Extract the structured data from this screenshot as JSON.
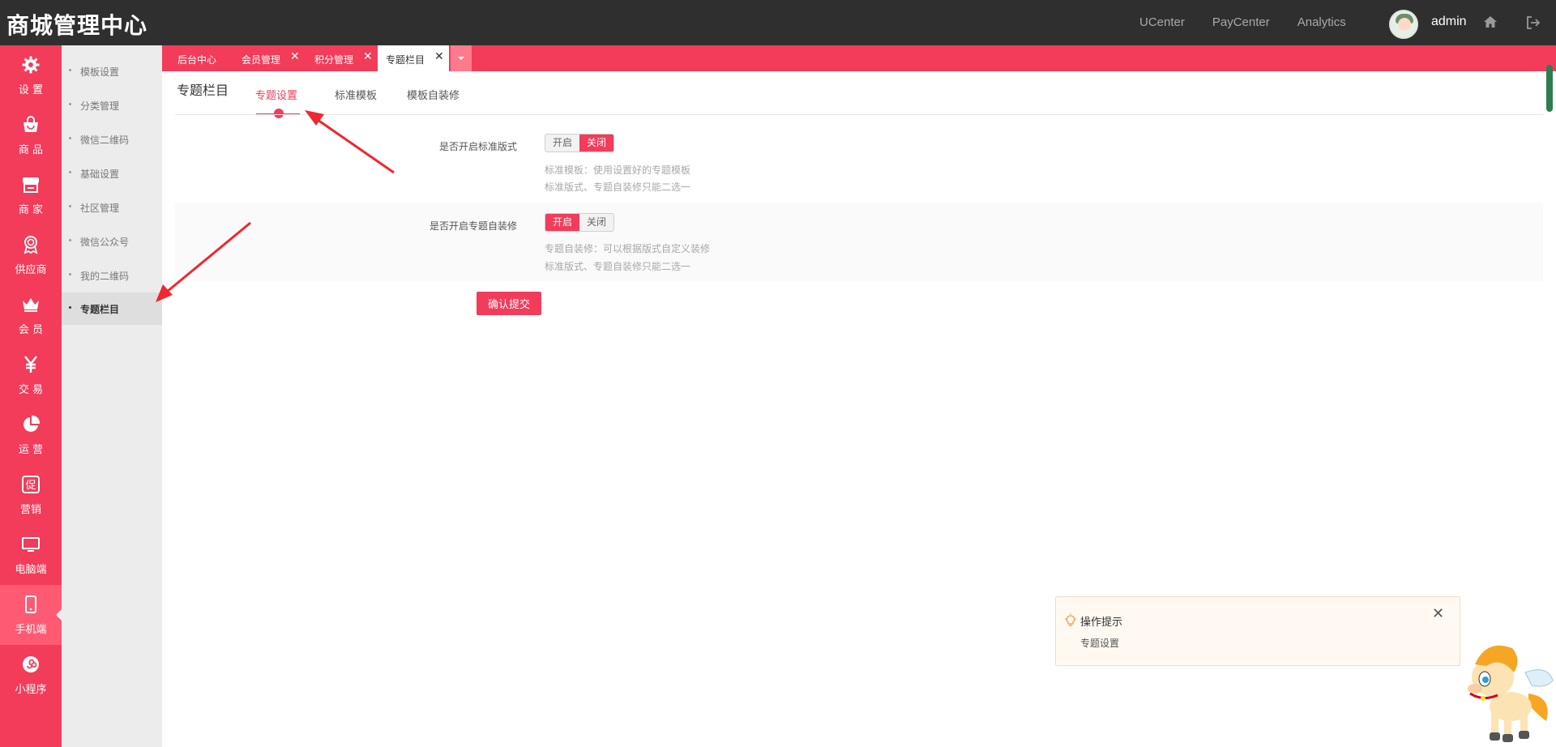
{
  "header": {
    "brand": "商城管理中心",
    "links": [
      "UCenter",
      "PayCenter",
      "Analytics"
    ],
    "username": "admin"
  },
  "primary_nav": [
    {
      "label": "设 置",
      "icon": "gear-icon"
    },
    {
      "label": "商 品",
      "icon": "bag-icon"
    },
    {
      "label": "商 家",
      "icon": "store-icon"
    },
    {
      "label": "供应商",
      "icon": "badge-icon"
    },
    {
      "label": "会 员",
      "icon": "crown-icon"
    },
    {
      "label": "交 易",
      "icon": "yen-icon"
    },
    {
      "label": "运 营",
      "icon": "pie-chart-icon"
    },
    {
      "label": "营销",
      "icon": "promo-icon"
    },
    {
      "label": "电脑端",
      "icon": "monitor-icon"
    },
    {
      "label": "手机端",
      "icon": "mobile-icon",
      "active": true
    },
    {
      "label": "小程序",
      "icon": "miniprogram-icon"
    }
  ],
  "secondary_nav": [
    {
      "label": "模板设置"
    },
    {
      "label": "分类管理"
    },
    {
      "label": "微信二维码"
    },
    {
      "label": "基础设置"
    },
    {
      "label": "社区管理"
    },
    {
      "label": "微信公众号"
    },
    {
      "label": "我的二维码"
    },
    {
      "label": "专题栏目",
      "active": true
    }
  ],
  "tabs": [
    {
      "label": "后台中心",
      "closable": false
    },
    {
      "label": "会员管理",
      "closable": true
    },
    {
      "label": "积分管理",
      "closable": true
    },
    {
      "label": "专题栏目",
      "closable": true,
      "active": true
    }
  ],
  "tab_close_glyph": "✕",
  "page": {
    "title": "专题栏目",
    "subtabs": [
      "专题设置",
      "标准模板",
      "模板自装修"
    ],
    "active_subtab": 0
  },
  "form": {
    "row1": {
      "label": "是否开启标准版式",
      "on_label": "开启",
      "off_label": "关闭",
      "value": "关闭",
      "hint1": "标准模板：使用设置好的专题模板",
      "hint2": "标准版式、专题自装修只能二选一"
    },
    "row2": {
      "label": "是否开启专题自装修",
      "on_label": "开启",
      "off_label": "关闭",
      "value": "开启",
      "hint1": "专题自装修：可以根据版式自定义装修",
      "hint2": "标准版式、专题自装修只能二选一"
    },
    "submit_label": "确认提交"
  },
  "tip": {
    "title": "操作提示",
    "body": "专题设置",
    "close_glyph": "✕"
  },
  "colors": {
    "accent": "#f23c5a",
    "topbar": "#2f2f2f",
    "secondary_bg": "#ececec"
  }
}
